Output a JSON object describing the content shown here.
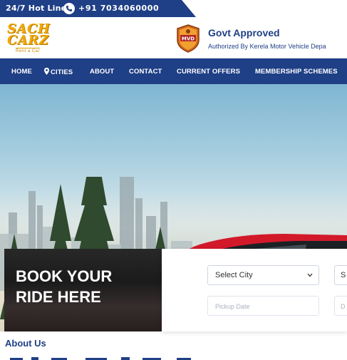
{
  "topbar": {
    "hotline_label": "24/7 Hot Line",
    "phone_number": "+91 7034060000",
    "icon": "phone-icon",
    "color": "#1f3f86"
  },
  "header": {
    "logo_line1": "SACH",
    "logo_line2": "CARZ",
    "logo_tagline": "Rent a Car",
    "badge_text": "MVD",
    "govt_title": "Govt Approved",
    "govt_subtitle": "Authorized By Kerela Motor Vehicle Depa"
  },
  "nav": {
    "items": [
      {
        "label": "HOME"
      },
      {
        "label": "CITIES",
        "icon": "map-pin-icon"
      },
      {
        "label": "ABOUT"
      },
      {
        "label": "CONTACT"
      },
      {
        "label": "CURRENT OFFERS"
      },
      {
        "label": "MEMBERSHIP SCHEMES"
      }
    ]
  },
  "booking": {
    "title": "BOOK YOUR\nRIDE HERE",
    "city_select": "Select City",
    "right_select": "S",
    "pickup_placeholder": "Pickup Date",
    "drop_placeholder": "D"
  },
  "about": {
    "heading": "About Us"
  },
  "colors": {
    "brand_blue": "#1f3f86",
    "logo_gold": "#f2a900",
    "car_red": "#d2192a"
  }
}
